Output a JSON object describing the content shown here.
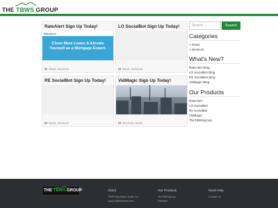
{
  "brand": {
    "logo_text_left": "THE ",
    "logo_text_green": "TBWS",
    "logo_text_right": " GROUP"
  },
  "colors": {
    "accent": "#1f8a34",
    "footer_bg": "#2b2e33",
    "card_bg": "#f7f7f7"
  },
  "posts": [
    {
      "title": "RateAlert Sign Up Today!",
      "meta": "News, Services",
      "media": "ratealert-ad"
    },
    {
      "title": "LO SocialBot Sign Up Today!",
      "meta": "News, Services",
      "media": "blank"
    },
    {
      "title": "RE SocialBot Sign Up Today!",
      "meta": "News, Services",
      "media": "blank"
    },
    {
      "title": "VidMagic Sign Up Today!",
      "meta": "Services, News",
      "media": "city-photo"
    }
  ],
  "ad": {
    "brand": "RateAlert",
    "line1": "Close More Loans & Elevate",
    "line2": "Yourself as a Mortgage Expert."
  },
  "sidebar": {
    "search": {
      "placeholder": "Search ...",
      "button": "Search"
    },
    "categories": {
      "title": "Categories",
      "items": [
        "> News",
        "> Services"
      ]
    },
    "whats_new": {
      "title": "What's New?",
      "items": [
        "RateAlert Blog",
        "LO SocialBot Blog",
        "RE SocialBot Blog",
        "VidMagic Blog"
      ]
    },
    "products": {
      "title": "Our Products",
      "items": [
        "RateAlert",
        "LO SocialBot",
        "Re SocialBot",
        "VidMagic",
        "TheTBWSgroup"
      ]
    }
  },
  "footer": {
    "logo_left": "THE ",
    "logo_green": "TBWS",
    "logo_right": " GROUP",
    "about": {
      "title": "About",
      "lines": [
        "TBWS Big Road, Small, Inc.",
        "support@tbwsmail.com"
      ]
    },
    "products": {
      "title": "Our Products",
      "lines": [
        "TheTBWSgroup",
        "Ratealert"
      ]
    },
    "help": {
      "title": "Need Help",
      "lines": [
        "Contact Us"
      ]
    }
  }
}
